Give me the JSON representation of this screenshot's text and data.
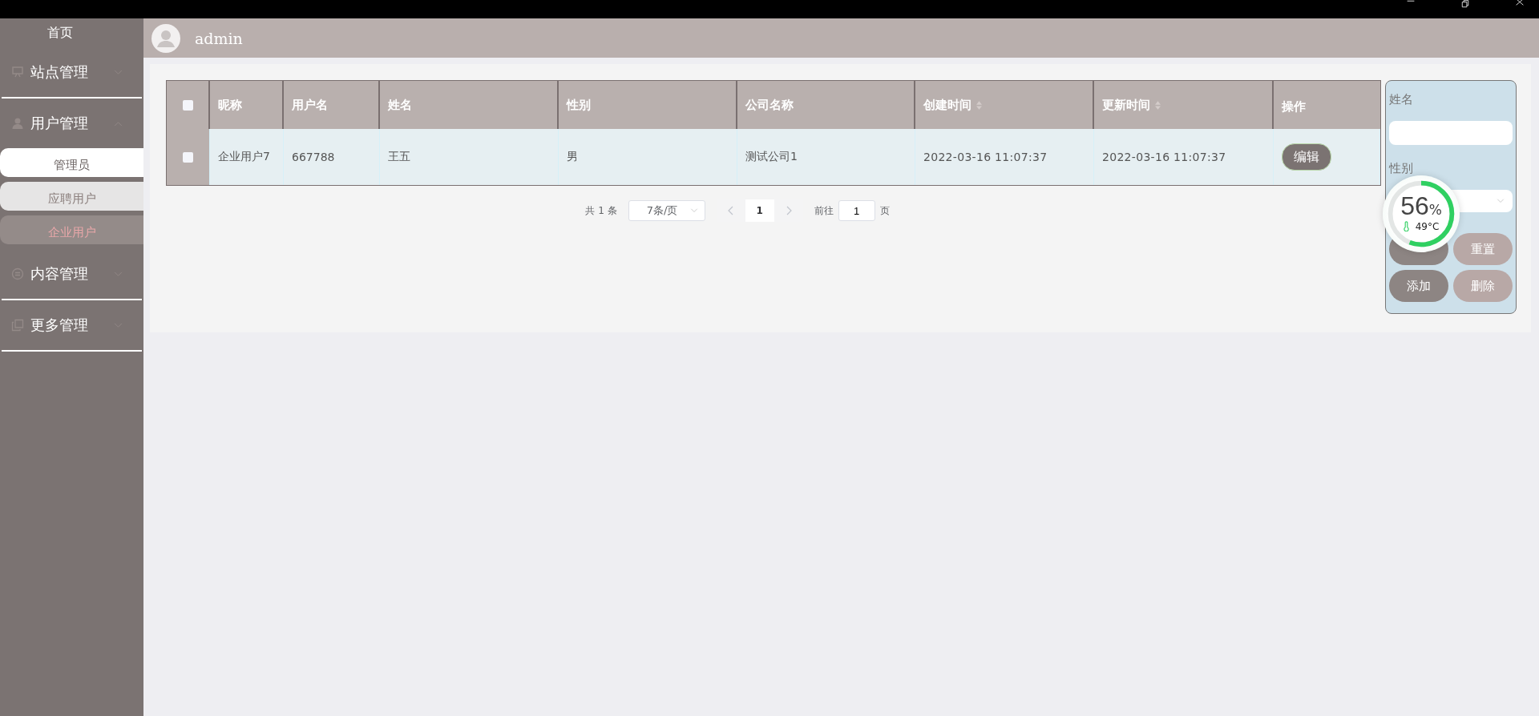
{
  "window_controls": [
    {
      "kind": "minimize"
    },
    {
      "kind": "restore"
    },
    {
      "kind": "close"
    }
  ],
  "sidebar": {
    "home": "首页",
    "groups": [
      {
        "label": "站点管理",
        "expanded": false
      },
      {
        "label": "用户管理",
        "expanded": true,
        "children": [
          {
            "label": "管理员",
            "selected": false,
            "hovered": true
          },
          {
            "label": "应聘用户",
            "selected": false,
            "hovered": false
          },
          {
            "label": "企业用户",
            "selected": true,
            "hovered": false
          }
        ]
      },
      {
        "label": "内容管理",
        "expanded": false
      },
      {
        "label": "更多管理",
        "expanded": false
      }
    ]
  },
  "header": {
    "user": "admin"
  },
  "table": {
    "all_checked": false,
    "columns": [
      {
        "label": "昵称",
        "sortable": false
      },
      {
        "label": "用户名",
        "sortable": false
      },
      {
        "label": "姓名",
        "sortable": false
      },
      {
        "label": "性别",
        "sortable": false
      },
      {
        "label": "公司名称",
        "sortable": false
      },
      {
        "label": "创建时间",
        "sortable": true
      },
      {
        "label": "更新时间",
        "sortable": true
      },
      {
        "label": "操作",
        "sortable": false
      }
    ],
    "rows": [
      {
        "checked": false,
        "cells": [
          "企业用户7",
          "667788",
          "王五",
          "男",
          "测试公司1",
          "2022-03-16 11:07:37",
          "2022-03-16 11:07:37"
        ],
        "action": "编辑"
      }
    ]
  },
  "pagination": {
    "total": "共 1 条",
    "page_size": "7条/页",
    "pages": [
      {
        "label": "1",
        "selected": true
      }
    ],
    "goto_label": "前往",
    "goto_value": "1",
    "page_suffix": "页"
  },
  "filter": {
    "name_label": "姓名",
    "gender_label": "性别",
    "buttons": [
      {
        "kind": "primary"
      },
      {
        "label": "重置",
        "kind": "muted"
      },
      {
        "label": "添加",
        "kind": "primary"
      },
      {
        "label": "删除",
        "kind": "muted"
      }
    ]
  },
  "monitor_widget": {
    "value": "56",
    "unit": "%",
    "level": 0.56,
    "temperature": "49°C"
  }
}
